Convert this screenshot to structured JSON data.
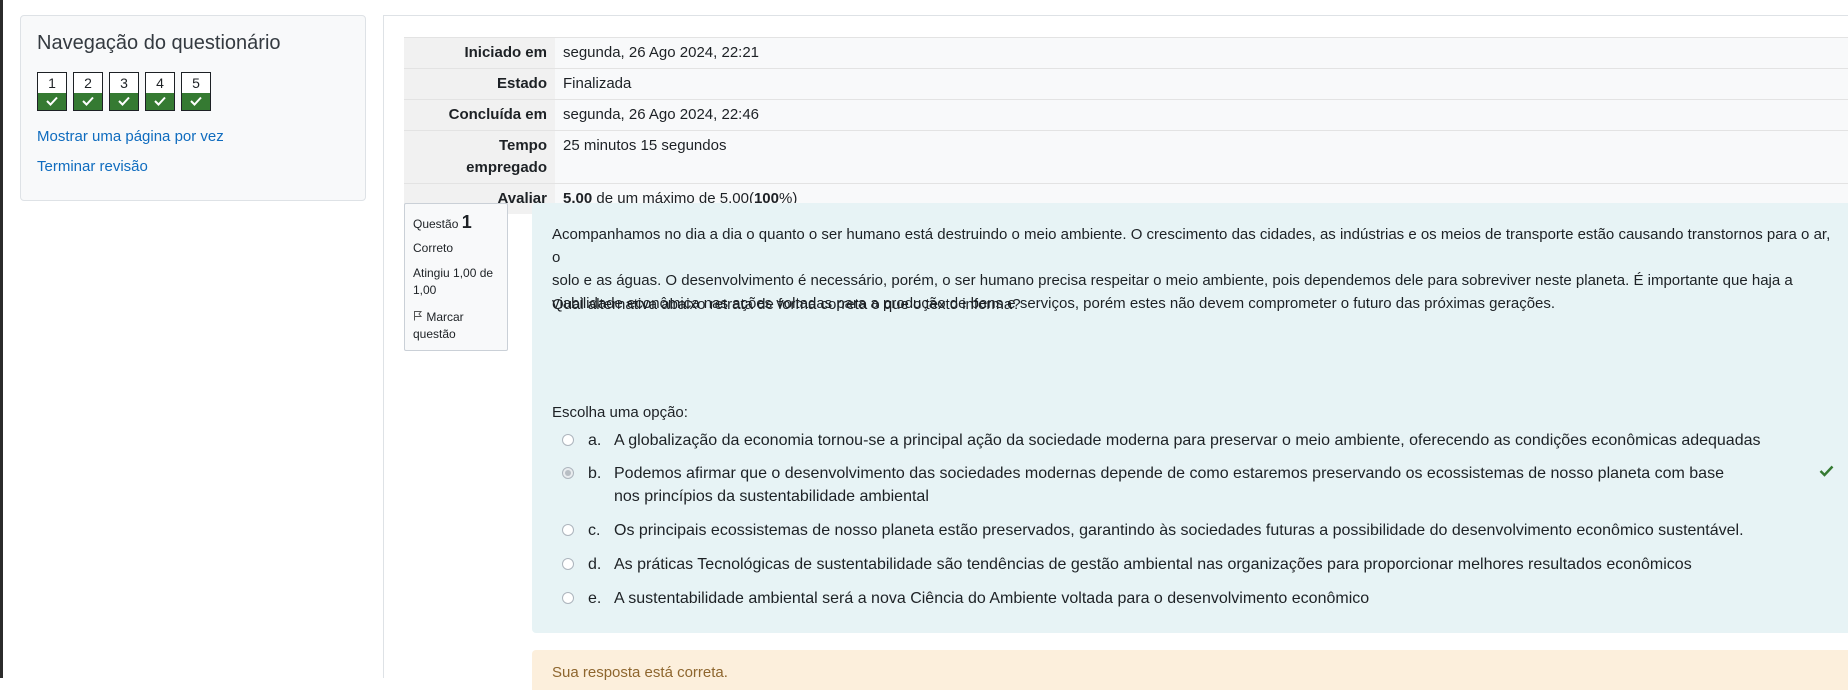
{
  "nav": {
    "title": "Navegação do questionário",
    "questions": [
      "1",
      "2",
      "3",
      "4",
      "5"
    ],
    "link_one_page": "Mostrar uma página por vez",
    "link_finish": "Terminar revisão"
  },
  "summary": {
    "started_label": "Iniciado em",
    "started_value": "segunda, 26 Ago 2024, 22:21",
    "state_label": "Estado",
    "state_value": "Finalizada",
    "completed_label": "Concluída em",
    "completed_value": "segunda, 26 Ago 2024, 22:46",
    "time_label_1": "Tempo",
    "time_label_2": "empregado",
    "time_value": "25 minutos 15 segundos",
    "grade_label": "Avaliar",
    "grade_score": "5,00",
    "grade_mid": " de um máximo de 5,00(",
    "grade_pct": "100",
    "grade_end": "%)"
  },
  "question": {
    "label": "Questão",
    "number": "1",
    "state": "Correto",
    "grade": "Atingiu 1,00 de 1,00",
    "flag": "Marcar questão",
    "text_line1": "Acompanhamos no dia a dia o quanto o ser humano está destruindo o meio ambiente. O crescimento das cidades, as indústrias e os meios de transporte estão causando transtornos para o ar, o",
    "text_line2": "solo e as águas. O desenvolvimento é necessário, porém, o ser humano precisa respeitar o meio ambiente, pois dependemos dele para sobreviver neste planeta. É importante que haja a",
    "text_line3": "viabilidade econômica nas ações voltadas para a produção de bens e serviços, porém estes não devem comprometer o futuro das próximas gerações.",
    "prompt": "Qual alternativa abaixo retrata de forma correta o que o texto informa?",
    "choose_label": "Escolha uma opção:",
    "options": [
      {
        "letter": "a.",
        "text": "A globalização da economia tornou-se a principal ação da sociedade moderna para preservar o meio ambiente, oferecendo as condições econômicas adequadas"
      },
      {
        "letter": "b.",
        "text": " Podemos afirmar que o desenvolvimento das sociedades modernas depende de como estaremos preservando os ecossistemas de nosso planeta com base nos princípios da sustentabilidade ambiental"
      },
      {
        "letter": "c.",
        "text": "Os principais ecossistemas de nosso planeta estão preservados, garantindo às sociedades futuras a possibilidade do desenvolvimento econômico sustentável."
      },
      {
        "letter": "d.",
        "text": " As práticas Tecnológicas de sustentabilidade são tendências de gestão  ambiental nas organizações para proporcionar melhores resultados econômicos"
      },
      {
        "letter": "e.",
        "text": "A sustentabilidade ambiental será a nova Ciência do Ambiente voltada para o desenvolvimento econômico"
      }
    ],
    "selected": "b.",
    "feedback": "Sua resposta está correta."
  },
  "colors": {
    "correct_green": "#357a32",
    "link_blue": "#0f6cbf",
    "qtext_bg": "#e7f3f5",
    "feedback_bg": "#fcefdc"
  }
}
